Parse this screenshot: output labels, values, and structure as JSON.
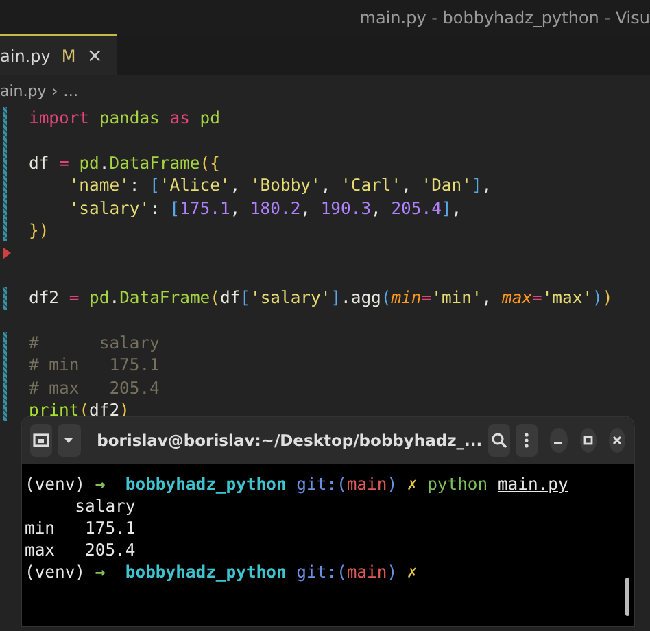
{
  "window": {
    "title": "main.py - bobbyhadz_python - Visu"
  },
  "tabs": [
    {
      "label": "ain.py",
      "badge": "M",
      "close": "×",
      "selected": true
    }
  ],
  "breadcrumb": {
    "file": "ain.py",
    "separator": "›",
    "rest": "…"
  },
  "code_lines": [
    {
      "kind": "code",
      "modified": true,
      "deleted": false,
      "tokens": [
        {
          "text": "import ",
          "kind": "keyword"
        },
        {
          "text": "pandas",
          "kind": "module"
        },
        {
          "text": " as ",
          "kind": "keyword"
        },
        {
          "text": "pd",
          "kind": "module"
        }
      ]
    },
    {
      "kind": "blank",
      "modified": true,
      "deleted": false
    },
    {
      "kind": "code",
      "modified": true,
      "deleted": false,
      "tokens": [
        {
          "text": "df ",
          "kind": "plain"
        },
        {
          "text": "= ",
          "kind": "operator"
        },
        {
          "text": "pd",
          "kind": "module"
        },
        {
          "text": ".",
          "kind": "plain"
        },
        {
          "text": "DataFrame",
          "kind": "module"
        },
        {
          "text": "({",
          "kind": "bracket"
        }
      ]
    },
    {
      "kind": "code",
      "modified": true,
      "deleted": false,
      "tokens": [
        {
          "text": "    'name'",
          "kind": "string"
        },
        {
          "text": ": ",
          "kind": "plain"
        },
        {
          "text": "[",
          "kind": "bracket2"
        },
        {
          "text": "'Alice'",
          "kind": "string"
        },
        {
          "text": ", ",
          "kind": "plain"
        },
        {
          "text": "'Bobby'",
          "kind": "string"
        },
        {
          "text": ", ",
          "kind": "plain"
        },
        {
          "text": "'Carl'",
          "kind": "string"
        },
        {
          "text": ", ",
          "kind": "plain"
        },
        {
          "text": "'Dan'",
          "kind": "string"
        },
        {
          "text": "]",
          "kind": "bracket2"
        },
        {
          "text": ",",
          "kind": "plain"
        }
      ]
    },
    {
      "kind": "code",
      "modified": true,
      "deleted": false,
      "tokens": [
        {
          "text": "    'salary'",
          "kind": "string"
        },
        {
          "text": ": ",
          "kind": "plain"
        },
        {
          "text": "[",
          "kind": "bracket2"
        },
        {
          "text": "175.1",
          "kind": "number"
        },
        {
          "text": ", ",
          "kind": "plain"
        },
        {
          "text": "180.2",
          "kind": "number"
        },
        {
          "text": ", ",
          "kind": "plain"
        },
        {
          "text": "190.3",
          "kind": "number"
        },
        {
          "text": ", ",
          "kind": "plain"
        },
        {
          "text": "205.4",
          "kind": "number"
        },
        {
          "text": "]",
          "kind": "bracket2"
        },
        {
          "text": ",",
          "kind": "plain"
        }
      ]
    },
    {
      "kind": "code",
      "modified": true,
      "deleted": false,
      "tokens": [
        {
          "text": "})",
          "kind": "bracket"
        }
      ]
    },
    {
      "kind": "blank",
      "modified": false,
      "deleted": true
    },
    {
      "kind": "blank"
    },
    {
      "kind": "code",
      "modified": true,
      "deleted": false,
      "tokens": [
        {
          "text": "df2 ",
          "kind": "plain"
        },
        {
          "text": "= ",
          "kind": "operator"
        },
        {
          "text": "pd",
          "kind": "module"
        },
        {
          "text": ".",
          "kind": "plain"
        },
        {
          "text": "DataFrame",
          "kind": "module"
        },
        {
          "text": "(",
          "kind": "bracket"
        },
        {
          "text": "df",
          "kind": "plain"
        },
        {
          "text": "[",
          "kind": "bracket2"
        },
        {
          "text": "'salary'",
          "kind": "string"
        },
        {
          "text": "]",
          "kind": "bracket2"
        },
        {
          "text": ".agg",
          "kind": "plain"
        },
        {
          "text": "(",
          "kind": "bracket2"
        },
        {
          "text": "min",
          "kind": "param"
        },
        {
          "text": "=",
          "kind": "operator"
        },
        {
          "text": "'min'",
          "kind": "string"
        },
        {
          "text": ", ",
          "kind": "plain"
        },
        {
          "text": "max",
          "kind": "param"
        },
        {
          "text": "=",
          "kind": "operator"
        },
        {
          "text": "'max'",
          "kind": "string"
        },
        {
          "text": ")",
          "kind": "bracket2"
        },
        {
          "text": ")",
          "kind": "bracket"
        }
      ]
    },
    {
      "kind": "blank"
    },
    {
      "kind": "code",
      "modified": true,
      "deleted": false,
      "tokens": [
        {
          "text": "#      salary",
          "kind": "comment"
        }
      ]
    },
    {
      "kind": "code",
      "modified": true,
      "deleted": false,
      "tokens": [
        {
          "text": "# min   175.1",
          "kind": "comment"
        }
      ]
    },
    {
      "kind": "code",
      "modified": true,
      "deleted": false,
      "tokens": [
        {
          "text": "# max   205.4",
          "kind": "comment"
        }
      ]
    },
    {
      "kind": "code",
      "modified": true,
      "deleted": false,
      "tokens": [
        {
          "text": "print",
          "kind": "function"
        },
        {
          "text": "(",
          "kind": "bracket"
        },
        {
          "text": "df2",
          "kind": "plain"
        },
        {
          "text": ")",
          "kind": "bracket"
        }
      ]
    }
  ],
  "terminal": {
    "title": "borislav@borislav:~/Desktop/bobbyhadz_...",
    "lines": [
      {
        "tokens": [
          {
            "text": "(venv) ",
            "kind": "plain"
          },
          {
            "text": "→  ",
            "kind": "arrow"
          },
          {
            "text": "bobbyhadz_python ",
            "kind": "dir"
          },
          {
            "text": "git:(",
            "kind": "git"
          },
          {
            "text": "main",
            "kind": "branch"
          },
          {
            "text": ") ",
            "kind": "git"
          },
          {
            "text": "✗ ",
            "kind": "dirty"
          },
          {
            "text": "python ",
            "kind": "command"
          },
          {
            "text": "main.py",
            "kind": "path"
          }
        ]
      },
      {
        "tokens": [
          {
            "text": "     salary",
            "kind": "plain"
          }
        ]
      },
      {
        "tokens": [
          {
            "text": "min   175.1",
            "kind": "plain"
          }
        ]
      },
      {
        "tokens": [
          {
            "text": "max   205.4",
            "kind": "plain"
          }
        ]
      },
      {
        "tokens": [
          {
            "text": "(venv) ",
            "kind": "plain"
          },
          {
            "text": "→  ",
            "kind": "arrow"
          },
          {
            "text": "bobbyhadz_python ",
            "kind": "dir"
          },
          {
            "text": "git:(",
            "kind": "git"
          },
          {
            "text": "main",
            "kind": "branch"
          },
          {
            "text": ") ",
            "kind": "git"
          },
          {
            "text": "✗",
            "kind": "dirty"
          }
        ]
      }
    ]
  }
}
